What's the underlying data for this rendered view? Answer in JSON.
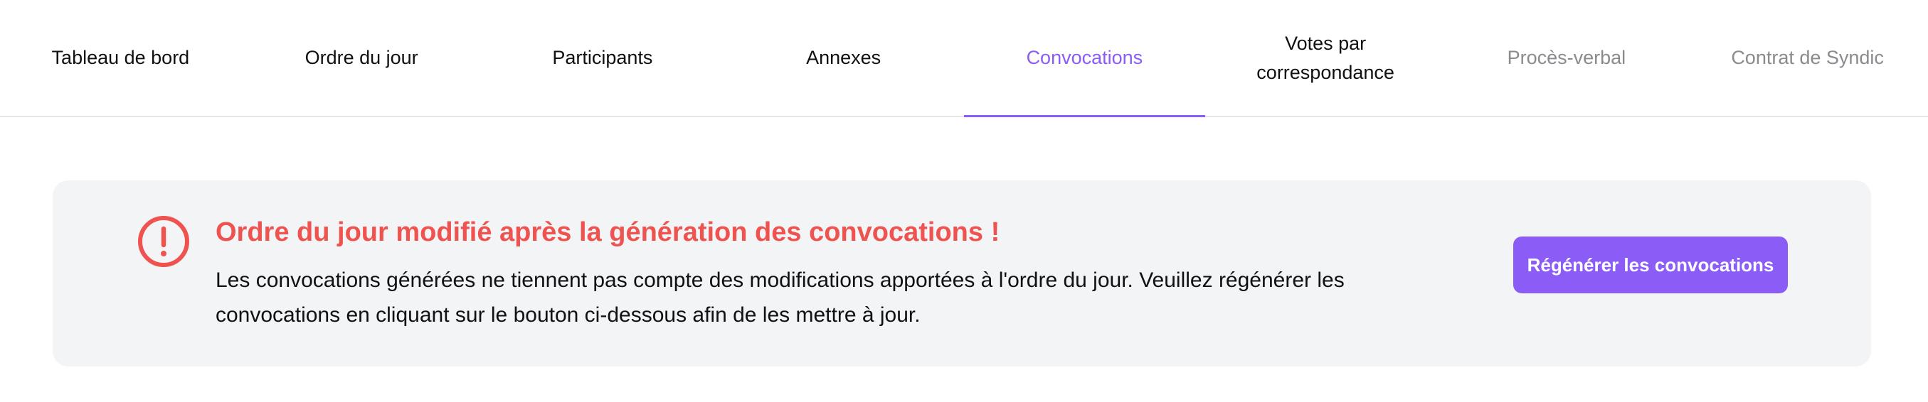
{
  "tabs": [
    {
      "label": "Tableau de bord",
      "state": "normal"
    },
    {
      "label": "Ordre du jour",
      "state": "normal"
    },
    {
      "label": "Participants",
      "state": "normal"
    },
    {
      "label": "Annexes",
      "state": "normal"
    },
    {
      "label": "Convocations",
      "state": "active"
    },
    {
      "label": "Votes par\ncorrespondance",
      "state": "normal"
    },
    {
      "label": "Procès-verbal",
      "state": "disabled"
    },
    {
      "label": "Contrat de Syndic",
      "state": "disabled"
    }
  ],
  "alert": {
    "icon": "exclamation-circle-icon",
    "title": "Ordre du jour modifié après la génération des convocations !",
    "body": "Les convocations générées ne tiennent pas compte des modifications apportées à l'ordre du jour. Veuillez régénérer les convocations en cliquant sur le bouton ci-dessous afin de les mettre à jour.",
    "button_label": "Régénérer les convocations"
  },
  "colors": {
    "accent": "#8b5cf6",
    "alert_red": "#ef5350",
    "alert_bg": "#f3f4f6",
    "muted_text": "#8a8a8f"
  }
}
